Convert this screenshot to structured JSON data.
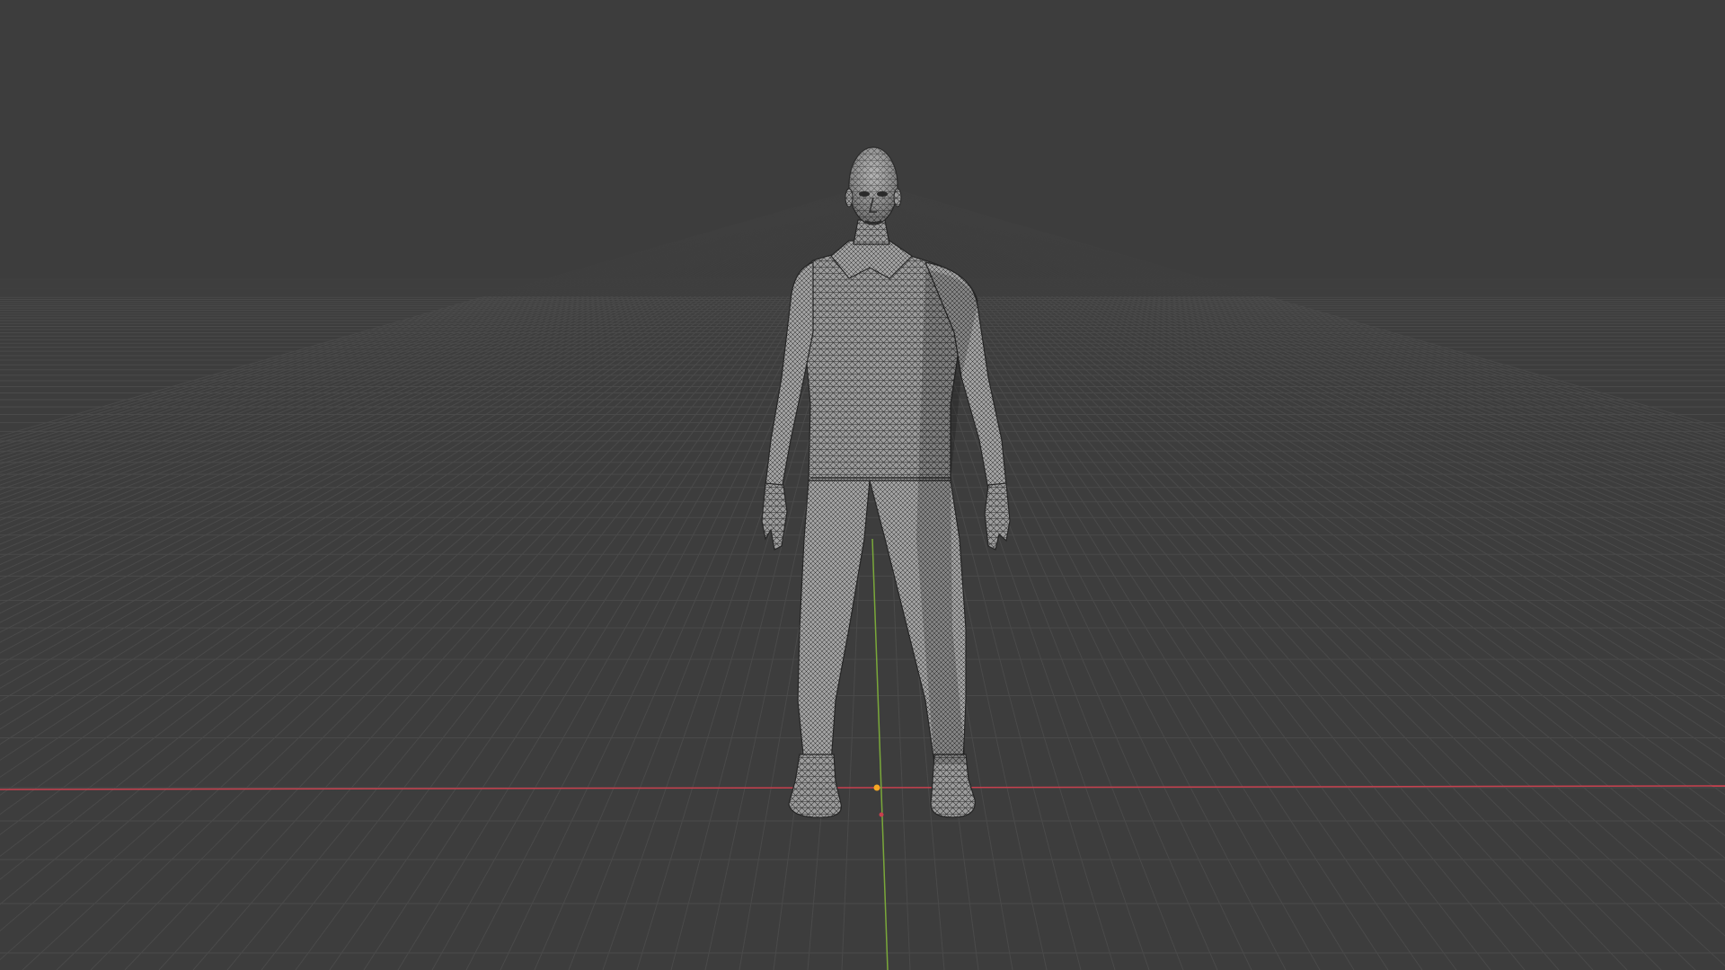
{
  "viewport": {
    "background_color": "#3d3d3d",
    "grid_color": "#4a4a4a",
    "x_axis_color": "#c7404e",
    "y_axis_color": "#7aa83a",
    "mesh_fill_color": "#9a9a9a",
    "mesh_wire_color": "#2a2a2a",
    "origin_marker_color": "#f5a623",
    "object": "human-figure-mesh",
    "shading_mode": "solid-wireframe"
  }
}
